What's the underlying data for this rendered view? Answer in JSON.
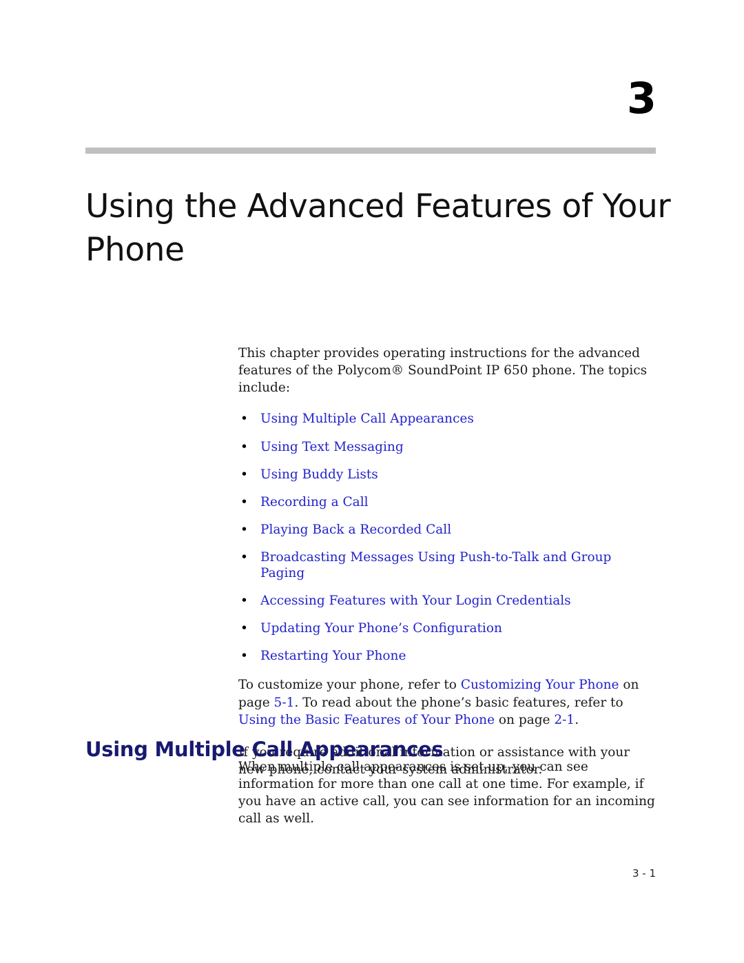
{
  "chapter": {
    "number": "3",
    "title": "Using the Advanced Features of Your Phone"
  },
  "intro": {
    "paragraph": "This chapter provides operating instructions for the advanced features of the Polycom® SoundPoint IP 650 phone. The topics include:"
  },
  "topics": {
    "bullet_glyph": "•",
    "items": [
      {
        "label": "Using Multiple Call Appearances"
      },
      {
        "label": "Using Text Messaging"
      },
      {
        "label": "Using Buddy Lists"
      },
      {
        "label": "Recording a Call"
      },
      {
        "label": "Playing Back a Recorded Call"
      },
      {
        "label": "Broadcasting Messages Using Push-to-Talk and Group Paging"
      },
      {
        "label": "Accessing Features with Your Login Credentials"
      },
      {
        "label": "Updating Your Phone’s Configuration"
      },
      {
        "label": "Restarting Your Phone"
      }
    ]
  },
  "cross_reference": {
    "part1": "To customize your phone, refer to ",
    "link1": "Customizing Your Phone",
    "part2": " on page ",
    "page1": "5-1",
    "part3": ". To read about the phone’s basic features, refer to ",
    "link2": "Using the Basic Features of Your Phone",
    "part4": " on page ",
    "page2": "2-1",
    "part5": "."
  },
  "assistance": {
    "paragraph": "If you require additional information or assistance with your new phone, contact your system administrator."
  },
  "section": {
    "heading": "Using Multiple Call Appearances",
    "paragraph": "When multiple call appearances is set up, you can see information for more than one call at one time. For example, if you have an active call, you can see information for an incoming call as well."
  },
  "footer": {
    "page_number": "3 - 1"
  },
  "colors": {
    "link": "#2222cc",
    "heading": "#191970",
    "rule": "#bfbfbf"
  }
}
